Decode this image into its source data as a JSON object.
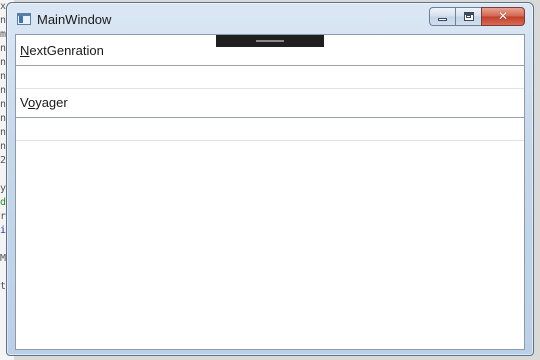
{
  "window": {
    "title": "MainWindow"
  },
  "rows": [
    {
      "access_key": "N",
      "label_rest": "extGenration",
      "field_value": ""
    },
    {
      "label_prefix": "V",
      "access_key": "o",
      "label_rest": "yager",
      "field_value": ""
    }
  ],
  "background_chars": [
    "x",
    "n",
    "m",
    "n",
    "n",
    "n",
    "n",
    "n",
    "n",
    "n",
    "n",
    "2",
    "",
    "y",
    "d",
    "r",
    "i",
    "",
    "M",
    "",
    "t"
  ],
  "colors": {
    "close_button": "#c0402a",
    "dock_handle": "#1f1f1f"
  },
  "icons": {
    "app": "window-app-icon",
    "minimize": "minimize-icon",
    "maximize": "maximize-icon",
    "close": "close-icon"
  }
}
